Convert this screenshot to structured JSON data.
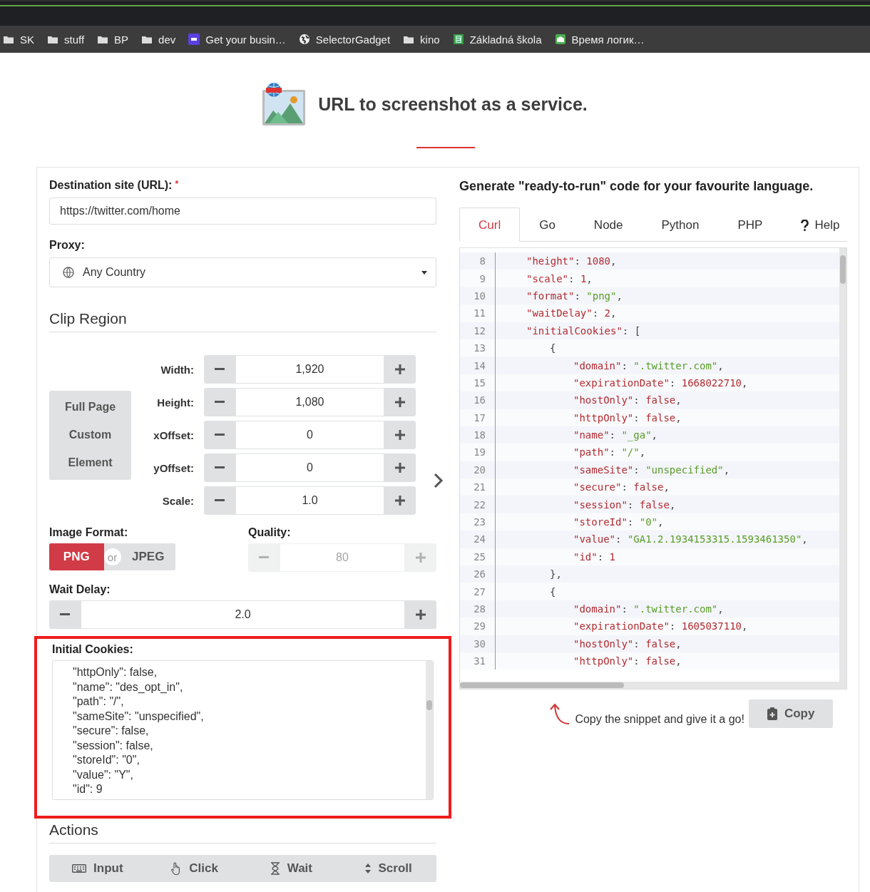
{
  "bookmarks": [
    {
      "label": "SK",
      "kind": "folder"
    },
    {
      "label": "stuff",
      "kind": "folder"
    },
    {
      "label": "BP",
      "kind": "folder"
    },
    {
      "label": "dev",
      "kind": "folder"
    },
    {
      "label": "Get your busin…",
      "kind": "ps"
    },
    {
      "label": "SelectorGadget",
      "kind": "globe"
    },
    {
      "label": "kino",
      "kind": "folder"
    },
    {
      "label": "Základná škola",
      "kind": "doc"
    },
    {
      "label": "Время логик…",
      "kind": "school"
    }
  ],
  "header": {
    "title": "URL to screenshot as a service."
  },
  "form": {
    "url": {
      "label": "Destination site (URL):",
      "required_mark": "*",
      "value": "https://twitter.com/home"
    },
    "proxy": {
      "label": "Proxy:",
      "value": "Any Country"
    },
    "clip_region": {
      "title": "Clip Region",
      "modes": [
        {
          "label": "Full Page",
          "selected": false
        },
        {
          "label": "Custom",
          "selected": false
        },
        {
          "label": "Element",
          "selected": false
        }
      ],
      "fields": [
        {
          "label": "Width:",
          "value": "1,920"
        },
        {
          "label": "Height:",
          "value": "1,080"
        },
        {
          "label": "xOffset:",
          "value": "0"
        },
        {
          "label": "yOffset:",
          "value": "0"
        },
        {
          "label": "Scale:",
          "value": "1.0"
        }
      ]
    },
    "image_format": {
      "label": "Image Format:",
      "options": [
        {
          "label": "PNG",
          "selected": true
        },
        {
          "label": "JPEG",
          "selected": false
        }
      ],
      "separator": "or"
    },
    "quality": {
      "label": "Quality:",
      "value": "80",
      "disabled": true
    },
    "wait_delay": {
      "label": "Wait Delay:",
      "value": "2.0"
    },
    "initial_cookies": {
      "label": "Initial Cookies:",
      "highlighted": true,
      "lines": [
        "\"httpOnly\": false,",
        "\"name\": \"des_opt_in\",",
        "\"path\": \"/\",",
        "\"sameSite\": \"unspecified\",",
        "\"secure\": false,",
        "\"session\": false,",
        "\"storeId\": \"0\",",
        "\"value\": \"Y\",",
        "\"id\": 9"
      ]
    },
    "actions": {
      "title": "Actions",
      "buttons": [
        {
          "label": "Input",
          "kind": "keyboard"
        },
        {
          "label": "Click",
          "kind": "hand"
        },
        {
          "label": "Wait",
          "kind": "hourglass"
        },
        {
          "label": "Scroll",
          "kind": "updown"
        }
      ]
    }
  },
  "code_panel": {
    "title": "Generate \"ready-to-run\" code for your favourite language.",
    "tabs": [
      {
        "label": "Curl",
        "selected": true,
        "kind": "lang"
      },
      {
        "label": "Go",
        "selected": false,
        "kind": "lang"
      },
      {
        "label": "Node",
        "selected": false,
        "kind": "lang"
      },
      {
        "label": "Python",
        "selected": false,
        "kind": "lang"
      },
      {
        "label": "PHP",
        "selected": false,
        "kind": "lang"
      },
      {
        "label": "Help",
        "selected": false,
        "kind": "help"
      }
    ],
    "lines": [
      {
        "number": "8",
        "kind": "prop",
        "tokens": [
          {
            "text": "\"height\"",
            "kind": "key"
          },
          {
            "text": ": ",
            "kind": "punct"
          },
          {
            "text": "1080",
            "kind": "num"
          },
          {
            "text": ",",
            "kind": "punct"
          }
        ]
      },
      {
        "number": "9",
        "kind": "prop",
        "tokens": [
          {
            "text": "\"scale\"",
            "kind": "key"
          },
          {
            "text": ": ",
            "kind": "punct"
          },
          {
            "text": "1",
            "kind": "num"
          },
          {
            "text": ",",
            "kind": "punct"
          }
        ]
      },
      {
        "number": "10",
        "kind": "prop",
        "tokens": [
          {
            "text": "\"format\"",
            "kind": "key"
          },
          {
            "text": ": ",
            "kind": "punct"
          },
          {
            "text": "\"png\"",
            "kind": "str"
          },
          {
            "text": ",",
            "kind": "punct"
          }
        ]
      },
      {
        "number": "11",
        "kind": "prop",
        "tokens": [
          {
            "text": "\"waitDelay\"",
            "kind": "key"
          },
          {
            "text": ": ",
            "kind": "punct"
          },
          {
            "text": "2",
            "kind": "num"
          },
          {
            "text": ",",
            "kind": "punct"
          }
        ]
      },
      {
        "number": "12",
        "kind": "prop",
        "tokens": [
          {
            "text": "\"initialCookies\"",
            "kind": "key"
          },
          {
            "text": ": [",
            "kind": "punct"
          }
        ]
      },
      {
        "number": "13",
        "kind": "brace",
        "tokens": [
          {
            "text": "{",
            "kind": "punct"
          }
        ]
      },
      {
        "number": "14",
        "kind": "item",
        "tokens": [
          {
            "text": "\"domain\"",
            "kind": "key"
          },
          {
            "text": ": ",
            "kind": "punct"
          },
          {
            "text": "\".twitter.com\"",
            "kind": "str"
          },
          {
            "text": ",",
            "kind": "punct"
          }
        ]
      },
      {
        "number": "15",
        "kind": "item",
        "tokens": [
          {
            "text": "\"expirationDate\"",
            "kind": "key"
          },
          {
            "text": ": ",
            "kind": "punct"
          },
          {
            "text": "1668022710",
            "kind": "num"
          },
          {
            "text": ",",
            "kind": "punct"
          }
        ]
      },
      {
        "number": "16",
        "kind": "item",
        "tokens": [
          {
            "text": "\"hostOnly\"",
            "kind": "key"
          },
          {
            "text": ": ",
            "kind": "punct"
          },
          {
            "text": "false",
            "kind": "num"
          },
          {
            "text": ",",
            "kind": "punct"
          }
        ]
      },
      {
        "number": "17",
        "kind": "item",
        "tokens": [
          {
            "text": "\"httpOnly\"",
            "kind": "key"
          },
          {
            "text": ": ",
            "kind": "punct"
          },
          {
            "text": "false",
            "kind": "num"
          },
          {
            "text": ",",
            "kind": "punct"
          }
        ]
      },
      {
        "number": "18",
        "kind": "item",
        "tokens": [
          {
            "text": "\"name\"",
            "kind": "key"
          },
          {
            "text": ": ",
            "kind": "punct"
          },
          {
            "text": "\"_ga\"",
            "kind": "str"
          },
          {
            "text": ",",
            "kind": "punct"
          }
        ]
      },
      {
        "number": "19",
        "kind": "item",
        "tokens": [
          {
            "text": "\"path\"",
            "kind": "key"
          },
          {
            "text": ": ",
            "kind": "punct"
          },
          {
            "text": "\"/\"",
            "kind": "str"
          },
          {
            "text": ",",
            "kind": "punct"
          }
        ]
      },
      {
        "number": "20",
        "kind": "item",
        "tokens": [
          {
            "text": "\"sameSite\"",
            "kind": "key"
          },
          {
            "text": ": ",
            "kind": "punct"
          },
          {
            "text": "\"unspecified\"",
            "kind": "str"
          },
          {
            "text": ",",
            "kind": "punct"
          }
        ]
      },
      {
        "number": "21",
        "kind": "item",
        "tokens": [
          {
            "text": "\"secure\"",
            "kind": "key"
          },
          {
            "text": ": ",
            "kind": "punct"
          },
          {
            "text": "false",
            "kind": "num"
          },
          {
            "text": ",",
            "kind": "punct"
          }
        ]
      },
      {
        "number": "22",
        "kind": "item",
        "tokens": [
          {
            "text": "\"session\"",
            "kind": "key"
          },
          {
            "text": ": ",
            "kind": "punct"
          },
          {
            "text": "false",
            "kind": "num"
          },
          {
            "text": ",",
            "kind": "punct"
          }
        ]
      },
      {
        "number": "23",
        "kind": "item",
        "tokens": [
          {
            "text": "\"storeId\"",
            "kind": "key"
          },
          {
            "text": ": ",
            "kind": "punct"
          },
          {
            "text": "\"0\"",
            "kind": "str"
          },
          {
            "text": ",",
            "kind": "punct"
          }
        ]
      },
      {
        "number": "24",
        "kind": "item",
        "tokens": [
          {
            "text": "\"value\"",
            "kind": "key"
          },
          {
            "text": ": ",
            "kind": "punct"
          },
          {
            "text": "\"GA1.2.1934153315.1593461350\"",
            "kind": "str"
          },
          {
            "text": ",",
            "kind": "punct"
          }
        ]
      },
      {
        "number": "25",
        "kind": "item",
        "tokens": [
          {
            "text": "\"id\"",
            "kind": "key"
          },
          {
            "text": ": ",
            "kind": "punct"
          },
          {
            "text": "1",
            "kind": "num"
          }
        ]
      },
      {
        "number": "26",
        "kind": "brace",
        "tokens": [
          {
            "text": "},",
            "kind": "punct"
          }
        ]
      },
      {
        "number": "27",
        "kind": "brace",
        "tokens": [
          {
            "text": "{",
            "kind": "punct"
          }
        ]
      },
      {
        "number": "28",
        "kind": "item",
        "tokens": [
          {
            "text": "\"domain\"",
            "kind": "key"
          },
          {
            "text": ": ",
            "kind": "punct"
          },
          {
            "text": "\".twitter.com\"",
            "kind": "str"
          },
          {
            "text": ",",
            "kind": "punct"
          }
        ]
      },
      {
        "number": "29",
        "kind": "item",
        "tokens": [
          {
            "text": "\"expirationDate\"",
            "kind": "key"
          },
          {
            "text": ": ",
            "kind": "punct"
          },
          {
            "text": "1605037110",
            "kind": "num"
          },
          {
            "text": ",",
            "kind": "punct"
          }
        ]
      },
      {
        "number": "30",
        "kind": "item",
        "tokens": [
          {
            "text": "\"hostOnly\"",
            "kind": "key"
          },
          {
            "text": ": ",
            "kind": "punct"
          },
          {
            "text": "false",
            "kind": "num"
          },
          {
            "text": ",",
            "kind": "punct"
          }
        ]
      },
      {
        "number": "31",
        "kind": "item",
        "tokens": [
          {
            "text": "\"httpOnly\"",
            "kind": "key"
          },
          {
            "text": ": ",
            "kind": "punct"
          },
          {
            "text": "false",
            "kind": "num"
          },
          {
            "text": ",",
            "kind": "punct"
          }
        ]
      }
    ],
    "hint": "Copy the snippet and give it a go!",
    "copy_button": "Copy"
  }
}
